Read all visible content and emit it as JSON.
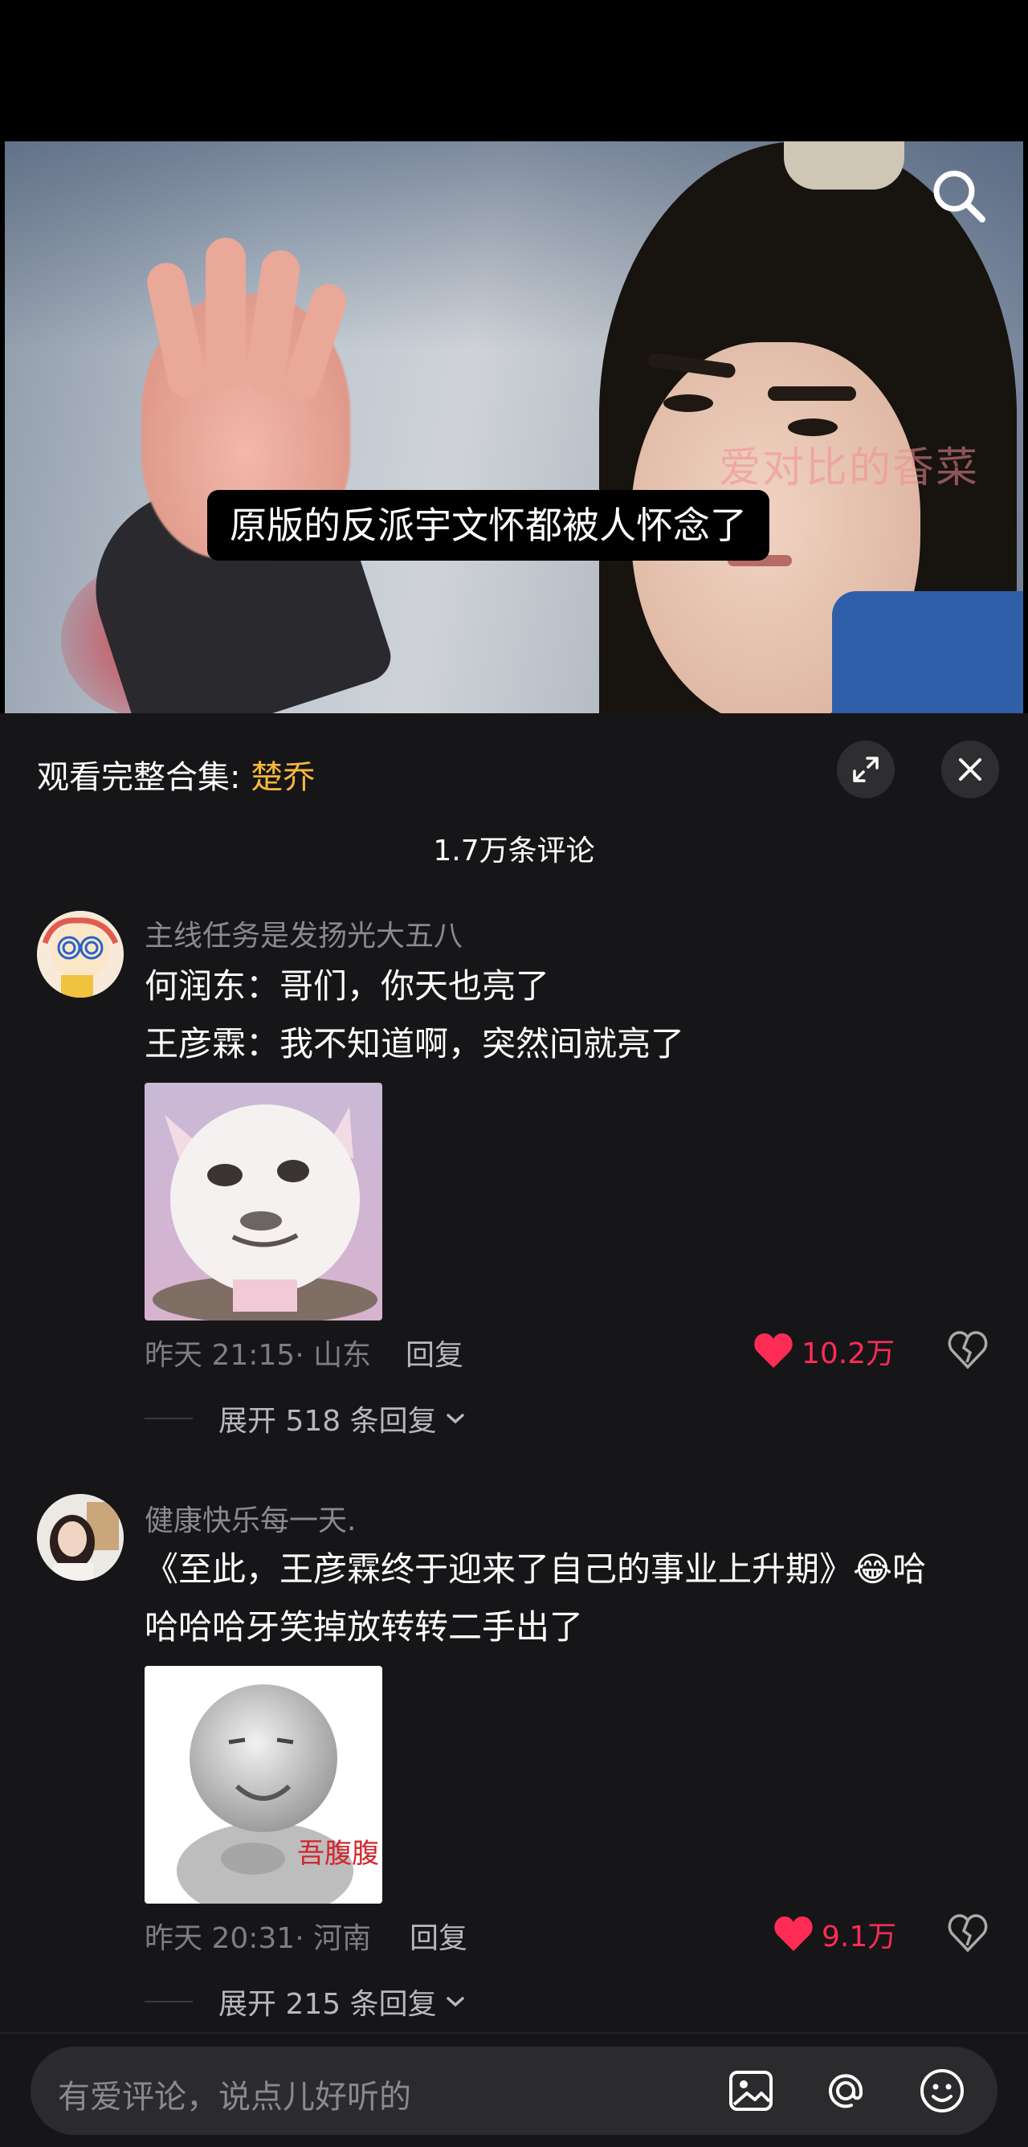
{
  "video": {
    "subtitle": "原版的反派宇文怀都被人怀念了",
    "watermark": "爱对比的香菜",
    "search_icon": "search-icon"
  },
  "collection": {
    "label": "观看完整合集: ",
    "name": "楚乔",
    "expand_icon": "expand-icon",
    "close_icon": "close-icon"
  },
  "comments_count": "1.7万条评论",
  "comments": [
    {
      "username": "主线任务是发扬光大五八",
      "line1": "何润东：哥们，你天也亮了",
      "line2": "王彦霖：我不知道啊，突然间就亮了",
      "time": "昨天 21:15",
      "location": "· 山东",
      "reply": "回复",
      "likes": "10.2万",
      "expand": "展开 518 条回复"
    },
    {
      "username": "健康快乐每一天.",
      "line1": "《至此，王彦霖终于迎来了自己的事业上升期》😂哈",
      "line2": "哈哈哈牙笑掉放转转二手出了",
      "sticker_text": "吾腹腹",
      "time": "昨天 20:31",
      "location": "· 河南",
      "reply": "回复",
      "likes": "9.1万",
      "expand": "展开 215 条回复"
    }
  ],
  "input": {
    "placeholder": "有爱评论，说点儿好听的",
    "icons": [
      "image-icon",
      "at-icon",
      "emoji-icon"
    ]
  },
  "colors": {
    "accent": "#f6b73c",
    "like": "#fe2c55",
    "panel": "#161618"
  }
}
